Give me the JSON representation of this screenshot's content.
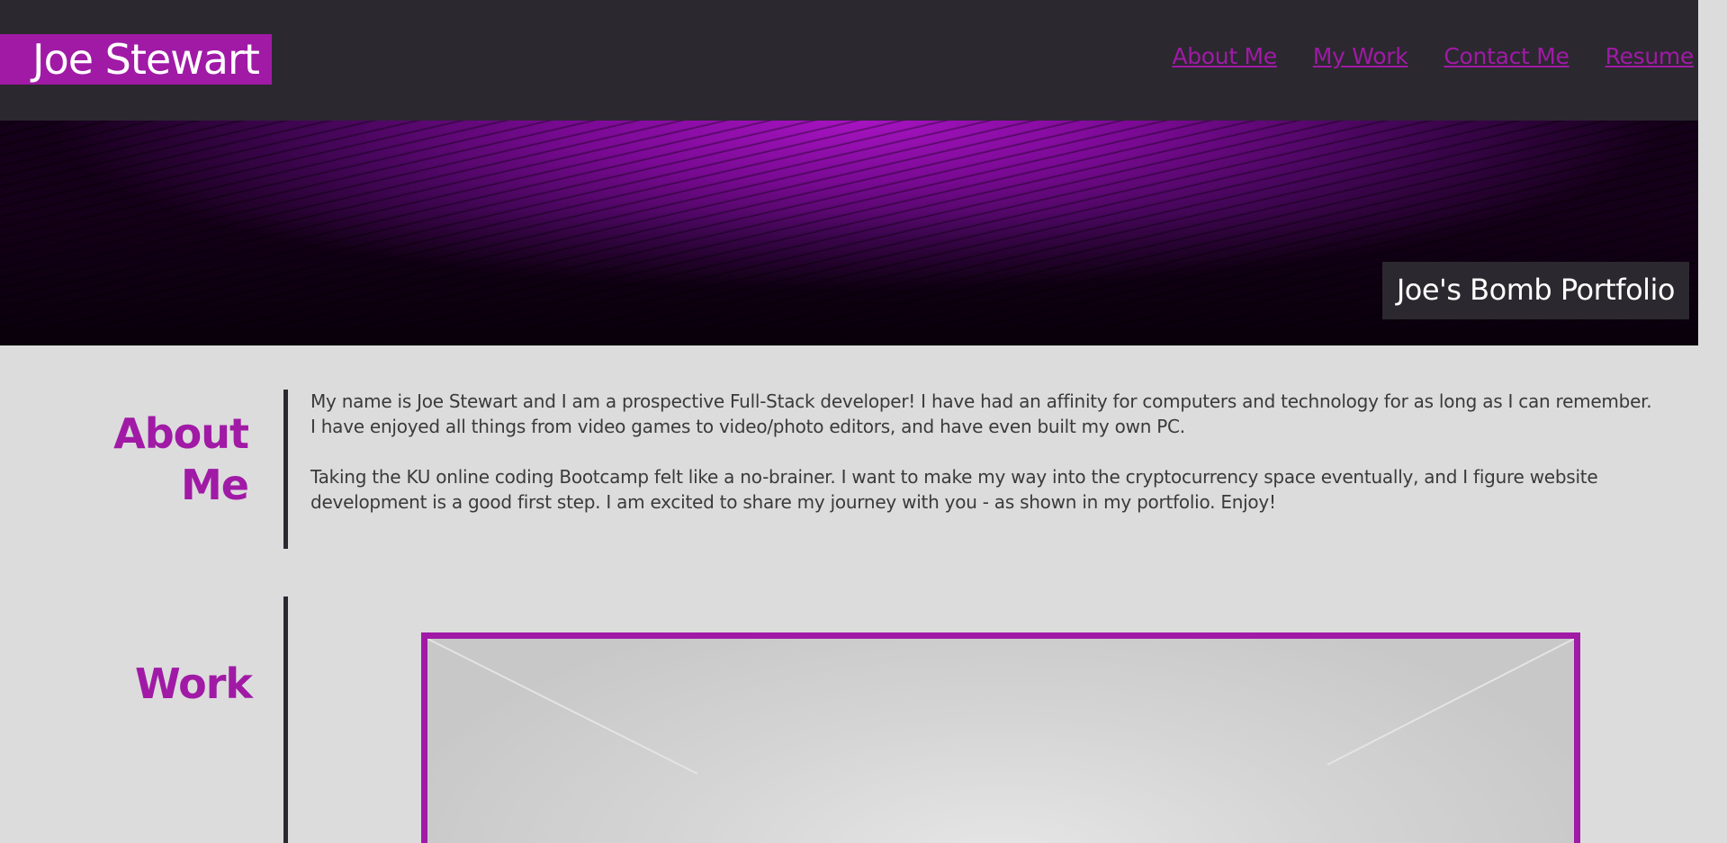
{
  "header": {
    "logo_text": "Joe Stewart",
    "nav": [
      {
        "label": "About Me"
      },
      {
        "label": "My Work"
      },
      {
        "label": "Contact Me"
      },
      {
        "label": "Resume"
      }
    ]
  },
  "hero": {
    "title": "Joe's Bomb Portfolio"
  },
  "about": {
    "heading": "About Me",
    "paragraphs": [
      "My name is Joe Stewart and I am a prospective Full-Stack developer! I have had an affinity for computers and technology for as long as I can remember. I have enjoyed all things from video games to video/photo editors, and have even built my own PC.",
      "Taking the KU online coding Bootcamp felt like a no-brainer. I want to make my way into the cryptocurrency space eventually, and I figure website development is a good first step. I am excited to share my journey with you - as shown in my portfolio. Enjoy!"
    ]
  },
  "work": {
    "heading": "Work"
  },
  "colors": {
    "accent": "#a01aa6",
    "header_bg": "#2c2830",
    "page_bg": "#dcdcdc",
    "text": "#3a3a3a"
  }
}
